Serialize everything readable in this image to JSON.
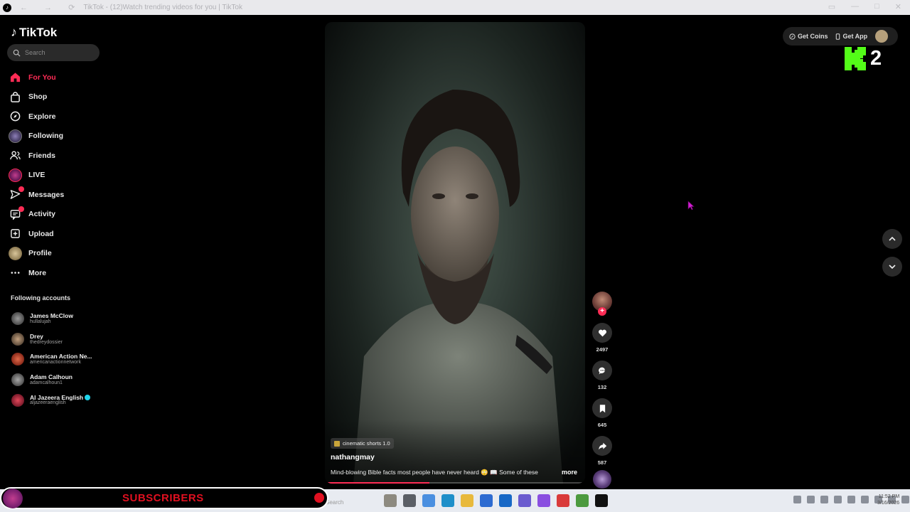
{
  "browser": {
    "title": "TikTok - (12)Watch trending videos for you | TikTok",
    "nav_glyphs": "← → ⟳"
  },
  "sidebar": {
    "logo_text": "TikTok",
    "search_placeholder": "Search",
    "nav": [
      {
        "label": "For You",
        "icon": "home-icon",
        "active": true
      },
      {
        "label": "Shop",
        "icon": "shopping-bag-icon"
      },
      {
        "label": "Explore",
        "icon": "compass-icon"
      },
      {
        "label": "Following",
        "icon": "following-avatar-icon"
      },
      {
        "label": "Friends",
        "icon": "friends-icon"
      },
      {
        "label": "LIVE",
        "icon": "live-icon"
      },
      {
        "label": "Messages",
        "icon": "messages-icon",
        "badge": true
      },
      {
        "label": "Activity",
        "icon": "activity-icon",
        "badge": true
      },
      {
        "label": "Upload",
        "icon": "upload-icon"
      },
      {
        "label": "Profile",
        "icon": "profile-avatar-icon"
      },
      {
        "label": "More",
        "icon": "more-dots-icon"
      }
    ],
    "following_title": "Following accounts",
    "accounts": [
      {
        "name": "James McClow",
        "username": "hullalujah",
        "color": "#6b6b6b"
      },
      {
        "name": "Drey",
        "username": "thedreydossier",
        "color": "#8a7560"
      },
      {
        "name": "American Action Ne...",
        "username": "americanactionnetwork",
        "color": "#b5462f"
      },
      {
        "name": "Adam Calhoun",
        "username": "adamcalhoun1",
        "color": "#7d7d7d"
      },
      {
        "name": "Al Jazeera English",
        "username": "aljazeeraenglish",
        "color": "#c9a23a",
        "verified": true
      }
    ]
  },
  "video": {
    "effect_label": "cinematic shorts 1.0",
    "author": "nathangmay",
    "description": "Mind-blowing Bible facts most people have never heard 😳 📖 Some of these",
    "more_label": "more",
    "progress": 0.4
  },
  "actions": {
    "likes": "2497",
    "comments": "132",
    "saves": "645",
    "shares": "587"
  },
  "topbar": {
    "get_coins": "Get Coins",
    "get_app": "Get App"
  },
  "kick_overlay": {
    "count": "2",
    "accent": "#53fc18"
  },
  "stream_overlay": {
    "label": "SUBSCRIBERS",
    "color": "#e01020"
  },
  "taskbar": {
    "search_placeholder": "Search",
    "time": "11:52 PM",
    "date": "3/16/2026"
  }
}
